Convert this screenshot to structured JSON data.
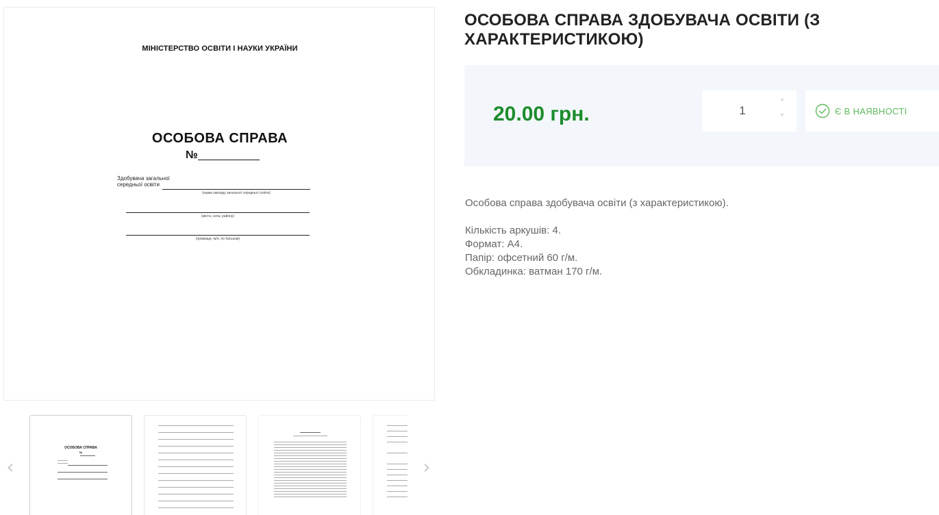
{
  "main_image": {
    "ministry": "МІНІСТЕРСТВО ОСВІТИ І НАУКИ УКРАЇНИ",
    "title": "ОСОБОВА СПРАВА",
    "number_label": "№",
    "field_line1": "Здобувача загальної",
    "field_line2": "середньої освіти",
    "caption1": "(назва закладу загальної середньої освіти)",
    "caption2": "(міста, села, району)",
    "caption3": "(прізвище, ім'я, по батькові)"
  },
  "thumbnails": {
    "prev_icon": "chevron-left-icon",
    "next_icon": "chevron-right-icon",
    "prev_glyph": "‹",
    "next_glyph": "›",
    "thumb1_title": "ОСОБОВА СПРАВА",
    "thumb1_number": "№"
  },
  "product": {
    "title": "ОСОБОВА СПРАВА ЗДОБУВАЧА ОСВІТИ (З ХАРАКТЕРИСТИКОЮ)",
    "price": "20.00 грн.",
    "quantity": "1",
    "qty_up_glyph": "˄",
    "qty_down_glyph": "˅",
    "stock_label": "Є В НАЯВНОСТІ",
    "stock_icon": "check-circle-icon",
    "description": "Особова справа здобувача освіти (з характеристикою).",
    "specs": [
      "Кількість аркушів: 4.",
      "Формат: А4.",
      "Папір: офсетний 60 г/м.",
      "Обкладинка: ватман 170 г/м."
    ]
  },
  "colors": {
    "price_green": "#1c8c2c",
    "stock_green": "#5db85d",
    "price_box_bg": "#f3f7fc"
  }
}
